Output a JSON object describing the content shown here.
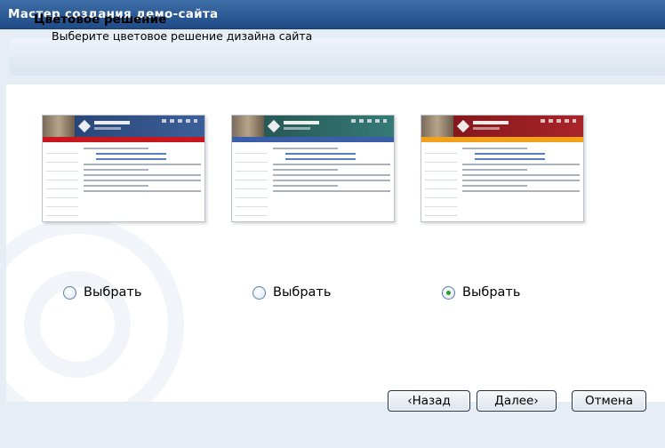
{
  "window": {
    "title": "Мастер создания демо-сайта"
  },
  "header": {
    "title": "Цветовое решение",
    "subtitle": "Выберите цветовое решение дизайна сайта"
  },
  "options": [
    {
      "label": "Выбрать",
      "checked": false,
      "theme_color": "#c8171f",
      "header_color": "#2b4b84"
    },
    {
      "label": "Выбрать",
      "checked": false,
      "theme_color": "#3a5fa8",
      "header_color": "#2f6c6a"
    },
    {
      "label": "Выбрать",
      "checked": true,
      "theme_color": "#f3a01a",
      "header_color": "#9a1b1e"
    }
  ],
  "buttons": {
    "back": "‹Назад",
    "next": "Далее›",
    "cancel": "Отмена"
  },
  "colors": {
    "titlebar": "#2c5a94",
    "frame": "#e6edf5",
    "content": "#ffffff"
  }
}
